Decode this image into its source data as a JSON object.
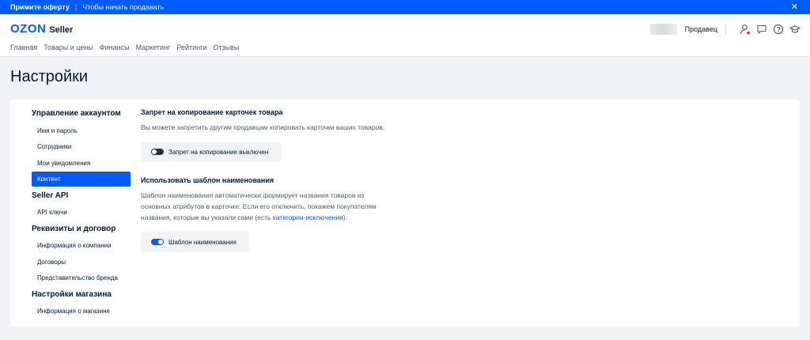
{
  "promo": {
    "offer": "Примите оферту",
    "text": "Чтобы начать продавать"
  },
  "header": {
    "brand": "OZON",
    "sub": "Seller",
    "seller_label": "Продавец",
    "nav": [
      "Главная",
      "Товары и цены",
      "Финансы",
      "Маркетинг",
      "Рейтинги",
      "Отзывы"
    ]
  },
  "page": {
    "title": "Настройки"
  },
  "sidebar": {
    "groups": [
      {
        "title": "Управление аккаунтом",
        "items": [
          "Имя и пароль",
          "Сотрудники",
          "Мои уведомления",
          "Контент"
        ]
      },
      {
        "title": "Seller API",
        "items": [
          "API ключи"
        ]
      },
      {
        "title": "Реквизиты и договор",
        "items": [
          "Информация о компании",
          "Договоры",
          "Представительство бренда"
        ]
      },
      {
        "title": "Настройки магазина",
        "items": [
          "Информация о магазине"
        ]
      }
    ],
    "active_item": "Контент"
  },
  "content": {
    "copy_ban": {
      "title": "Запрет на копирование карточек товара",
      "desc": "Вы можете запретить другим продавцам копировать карточки ваших товаров.",
      "toggle_label": "Запрет на копирование выключен",
      "toggle_on": false
    },
    "name_template": {
      "title": "Использовать шаблон наименования",
      "desc_before": "Шаблон наименования автоматически формирует названия товаров из основных атрибутов в карточке. Если его отключить, покажем покупателям названия, которые вы указали сами (есть ",
      "desc_link": "категории-исключения",
      "desc_after": ").",
      "toggle_label": "Шаблон наименования",
      "toggle_on": true
    }
  },
  "colors": {
    "accent": "#005bff",
    "background": "#f1f2f5",
    "text": "#001a34"
  },
  "icons": [
    "close-icon",
    "user-icon",
    "chat-icon",
    "help-icon",
    "graduation-cap-icon"
  ]
}
